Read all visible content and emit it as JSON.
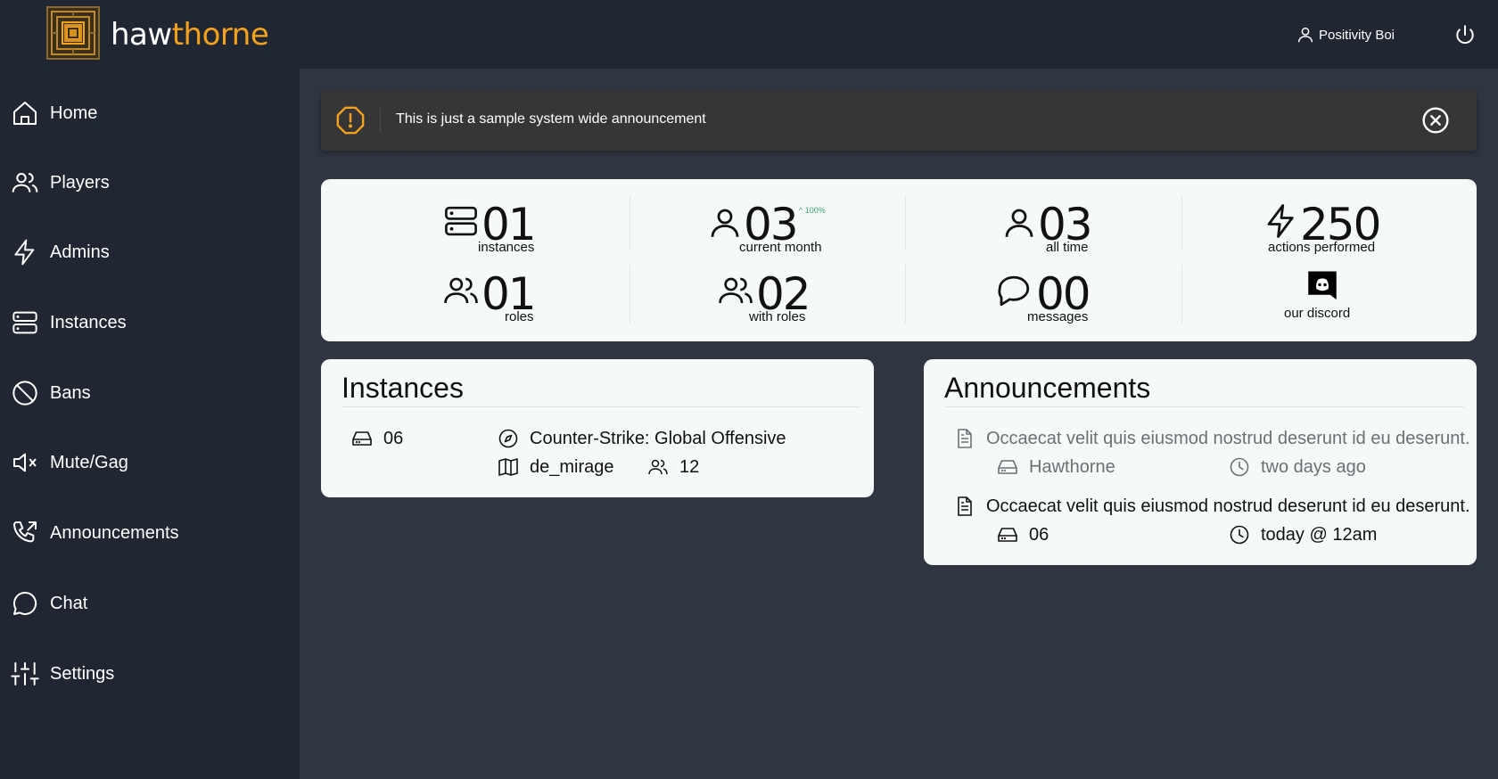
{
  "app": {
    "brand_part1": "haw",
    "brand_part2": "thorne",
    "brand_accent_color": "#f4a21d"
  },
  "header": {
    "user_name": "Positivity Boi",
    "user_icon": "user-icon",
    "power_icon": "power-icon"
  },
  "sidebar": {
    "items": [
      {
        "label": "Home",
        "icon": "home-icon"
      },
      {
        "label": "Players",
        "icon": "users-icon"
      },
      {
        "label": "Admins",
        "icon": "lightning-icon"
      },
      {
        "label": "Instances",
        "icon": "server-icon"
      },
      {
        "label": "Bans",
        "icon": "ban-icon"
      },
      {
        "label": "Mute/Gag",
        "icon": "mute-icon"
      },
      {
        "label": "Announcements",
        "icon": "phone-outgoing-icon"
      },
      {
        "label": "Chat",
        "icon": "chat-icon"
      },
      {
        "label": "Settings",
        "icon": "sliders-icon"
      }
    ]
  },
  "alert": {
    "text": "This is just a sample system wide announcement",
    "icon": "warning-octagon-icon",
    "close_icon": "close-circle-icon"
  },
  "stats": [
    {
      "value": "01",
      "label": "instances",
      "icon": "server-icon"
    },
    {
      "value": "03",
      "label": "current month",
      "icon": "user-icon",
      "trend": "^ 100%"
    },
    {
      "value": "03",
      "label": "all time",
      "icon": "user-icon"
    },
    {
      "value": "250",
      "label": "actions performed",
      "icon": "lightning-icon"
    },
    {
      "value": "01",
      "label": "roles",
      "icon": "users-icon"
    },
    {
      "value": "02",
      "label": "with roles",
      "icon": "users-icon"
    },
    {
      "value": "00",
      "label": "messages",
      "icon": "chat-square-icon"
    },
    {
      "value": "",
      "label": "our discord",
      "icon": "discord-icon"
    }
  ],
  "instances": {
    "title": "Instances",
    "items": [
      {
        "id": "06",
        "game": "Counter-Strike: Global Offensive",
        "map": "de_mirage",
        "players": "12"
      }
    ]
  },
  "announcements": {
    "title": "Announcements",
    "items": [
      {
        "text": "Occaecat velit quis eiusmod nostrud deserunt id eu deserunt.",
        "source": "Hawthorne",
        "time": "two days ago",
        "muted": true
      },
      {
        "text": "Occaecat velit quis eiusmod nostrud deserunt id eu deserunt.",
        "source": "06",
        "time": "today @ 12am",
        "muted": false
      }
    ]
  }
}
